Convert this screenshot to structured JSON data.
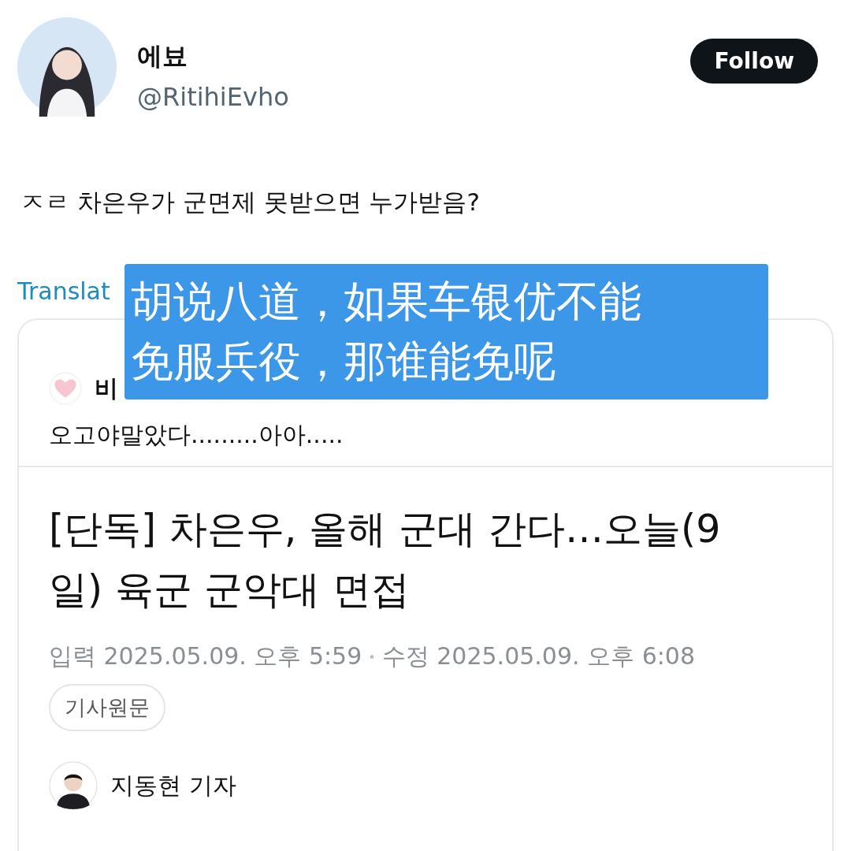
{
  "author": {
    "name": "에뵤",
    "handle": "@RitihiEvho"
  },
  "follow_button": {
    "label": "Follow"
  },
  "tweet_text": "ㅈㄹ 차은우가 군면제 못받으면 누가받음?",
  "translate_link": "Translat",
  "caption_overlay": {
    "lines": [
      "胡说八道，如果车银优不能",
      "免服兵役，那谁能免呢"
    ]
  },
  "quoted_tweet": {
    "author_name": "비",
    "text": "오고야말았다.........아아.....",
    "article": {
      "headline": "[단독] 차은우, 올해 군대 간다…오늘(9일) 육군 군악대 면접",
      "published": "입력 2025.05.09. 오후 5:59",
      "separator": "•",
      "edited": "수정 2025.05.09. 오후 6:08",
      "original_link": "기사원문",
      "reporter": "지동현 기자"
    }
  }
}
